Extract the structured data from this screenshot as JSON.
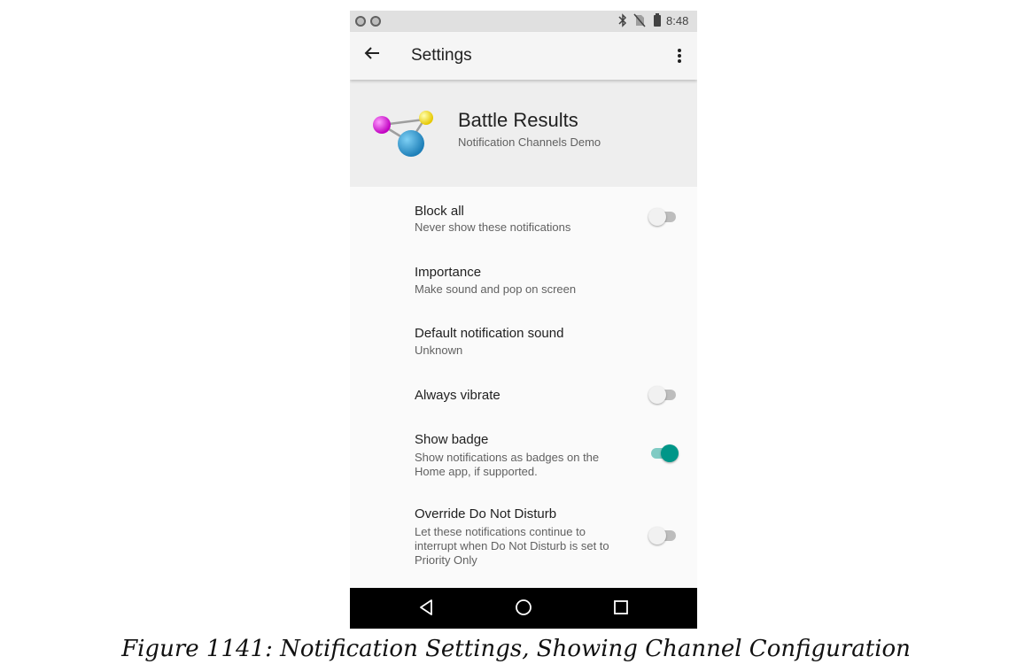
{
  "status_bar": {
    "time": "8:48",
    "icons": [
      "notification-dot-icon",
      "notification-dot-icon",
      "bluetooth-icon",
      "no-sim-icon",
      "battery-charging-icon"
    ]
  },
  "toolbar": {
    "title": "Settings",
    "back_icon": "arrow-back-icon",
    "menu_icon": "overflow-menu-icon"
  },
  "header": {
    "app_name": "Battle Results",
    "subtitle": "Notification Channels Demo",
    "logo_icon": "molecule-icon",
    "background": "#eeeeee"
  },
  "preferences": [
    {
      "title": "Block all",
      "summary": "Never show these notifications",
      "switch": "off"
    },
    {
      "title": "Importance",
      "summary": "Make sound and pop on screen"
    },
    {
      "title": "Default notification sound",
      "summary": "Unknown"
    },
    {
      "title": "Always vibrate",
      "summary": "",
      "switch": "off"
    },
    {
      "title": "Show badge",
      "summary": "Show notifications as badges on the Home app, if supported.",
      "switch": "on"
    },
    {
      "title": "Override Do Not Disturb",
      "summary": "Let these notifications continue to interrupt when Do Not Disturb is set to Priority Only",
      "switch": "off"
    }
  ],
  "navbar": {
    "buttons": [
      "back-triangle-icon",
      "home-circle-icon",
      "recents-square-icon"
    ]
  },
  "colors": {
    "accent": "#009688",
    "accent_track": "#80cbc4",
    "navbar": "#000000"
  },
  "caption": "Figure 1141: Notification Settings, Showing Channel Configuration"
}
